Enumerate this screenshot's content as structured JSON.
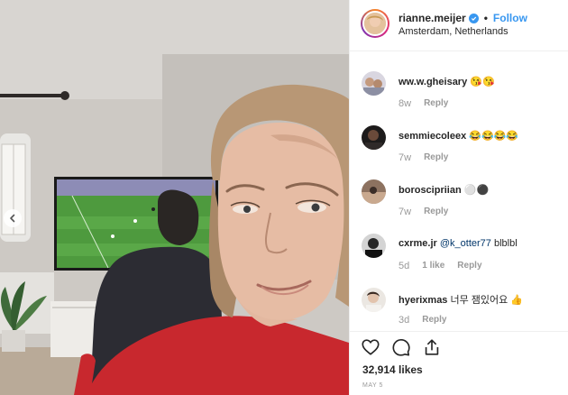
{
  "header": {
    "username": "rianne.meijer",
    "separator": "•",
    "follow_label": "Follow",
    "location": "Amsterdam, Netherlands"
  },
  "comments": [
    {
      "user": "ww.w.gheisary",
      "text": "😘😘",
      "time": "8w",
      "likes": "",
      "reply": "Reply"
    },
    {
      "user": "semmiecoleex",
      "text": "😂😂😂😂",
      "time": "7w",
      "likes": "",
      "reply": "Reply"
    },
    {
      "user": "boroscipriian",
      "text": "⚪⚫",
      "time": "7w",
      "likes": "",
      "reply": "Reply"
    },
    {
      "user": "cxrme.jr",
      "mention": "@k_otter77",
      "text": "blblbl",
      "time": "5d",
      "likes": "1 like",
      "reply": "Reply"
    },
    {
      "user": "hyerixmas",
      "text": "너무 잼있어요 👍",
      "time": "3d",
      "likes": "",
      "reply": "Reply"
    }
  ],
  "footer": {
    "likes": "32,914 likes",
    "date": "MAY 5"
  },
  "icons": {
    "like": "heart-icon",
    "comment": "comment-icon",
    "share": "share-icon",
    "verified": "verified-badge-icon",
    "carousel": "chevron-left-icon"
  },
  "colors": {
    "link": "#3897f0",
    "mention": "#003569",
    "muted": "#999999",
    "text": "#262626"
  }
}
